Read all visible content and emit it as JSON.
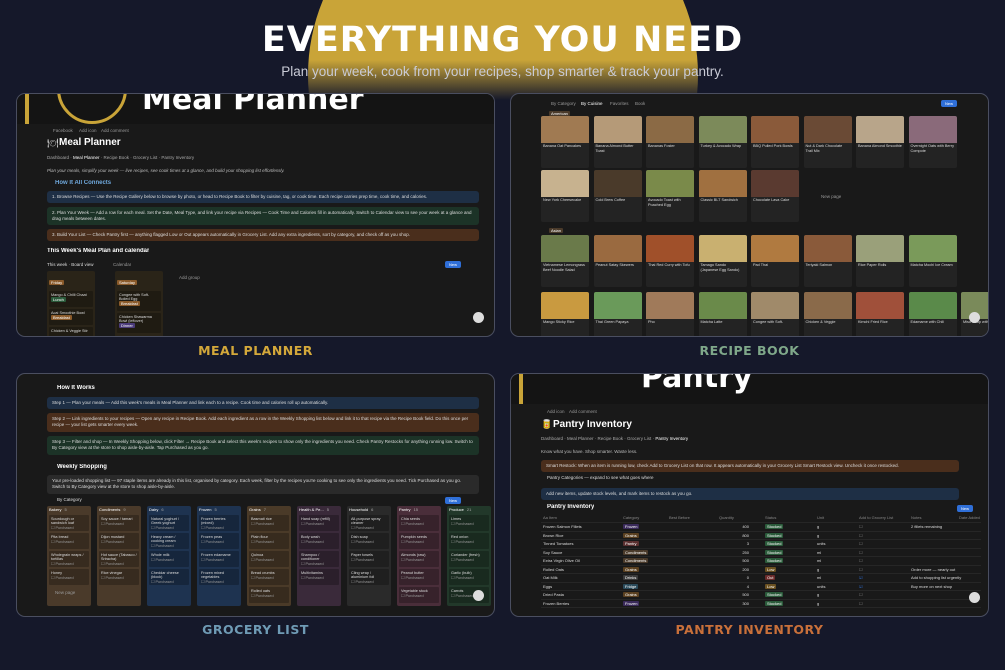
{
  "hero": {
    "title": "EVERYTHING YOU NEED",
    "subtitle": "Plan your week, cook from your recipes, shop smarter & track your pantry."
  },
  "captions": {
    "meal_planner": "MEAL PLANNER",
    "recipe_book": "RECIPE BOOK",
    "grocery_list": "GROCERY LIST",
    "pantry_inventory": "PANTRY INVENTORY"
  },
  "colors": {
    "gold": "#c9a438",
    "caption_gold": "#d4a83a",
    "caption_green": "#7fa88a",
    "caption_blue": "#6f9bb5",
    "caption_orange": "#c9703a",
    "button_blue": "#2f6fd8"
  },
  "meal_planner": {
    "cover_text": "Meal Planner",
    "cover_links": [
      "Facebook",
      "Add icon",
      "Add comment"
    ],
    "title": "Meal Planner",
    "breadcrumb": [
      "Dashboard",
      "Meal Planner",
      "Recipe Book",
      "Grocery List",
      "Pantry Inventory"
    ],
    "intro": "Plan your meals, simplify your week — live recipes, see cook times at a glance, and build your shopping list effortlessly.",
    "section_how": "How It All Connects",
    "steps": [
      "1. Browse Recipes — Use the Recipe Gallery below to browse by photo, or head to Recipe Book to filter by cuisine, tag, or cook time. Each recipe carries prep time, cook time, and calories.",
      "2. Plan Your Week — Add a row for each meal. Set the Date, Meal Type, and link your recipe via Recipes — Cook Time and Calories fill in automatically. Switch to Calendar view to see your week at a glance and drag meals between dates.",
      "3. Build Your List — Check Pantry first — anything flagged Low or Out appears automatically in Grocery List. Add any extra ingredients, sort by category, and check off as you shop."
    ],
    "section_week": "This Week's Meal Plan and calendar",
    "views": [
      "This week · Board view",
      "Calendar"
    ],
    "new_label": "New",
    "columns": [
      {
        "day": "Friday",
        "cards": [
          {
            "name": "Mango & Chilli Chaat",
            "tag": "Lunch"
          },
          {
            "name": "Acai Smoothie Bowl",
            "tag": "Breakfast"
          },
          {
            "name": "Chicken & Veggie Stir",
            "tag": ""
          }
        ]
      },
      {
        "day": "Saturday",
        "cards": [
          {
            "name": "Congee with Soft-Boiled Egg",
            "tag": "Breakfast"
          },
          {
            "name": "Chicken Shawarma Bowl (leftover)",
            "tag": "Dinner"
          }
        ]
      }
    ],
    "add_group": "Add group"
  },
  "recipe_book": {
    "tabs": [
      "By Category",
      "By Cuisine",
      "Favorites",
      "Book"
    ],
    "new_label": "New",
    "group1": "American",
    "group2": "Asian",
    "new_page": "New page",
    "row1": [
      {
        "name": "Banana Oat Pancakes",
        "color": "#a07a52"
      },
      {
        "name": "Banana Almond Butter Toast",
        "color": "#b59a78"
      },
      {
        "name": "Bananas Foster",
        "color": "#8b6a45"
      },
      {
        "name": "Turkey & Avocado Wrap",
        "color": "#7c8a5a"
      },
      {
        "name": "BBQ Pulled Pork Bowls",
        "color": "#8a5a3a"
      },
      {
        "name": "Nut & Dark Chocolate Trail Mix",
        "color": "#6a4a35"
      },
      {
        "name": "Banana Almond Smoothie",
        "color": "#b8a58a"
      },
      {
        "name": "Overnight Oats with Berry Compote",
        "color": "#8a6a7a"
      }
    ],
    "row2": [
      {
        "name": "New York Cheesecake",
        "color": "#c7b28f"
      },
      {
        "name": "Cold Brew Coffee",
        "color": "#4a3a2a"
      },
      {
        "name": "Avocado Toast with Poached Egg",
        "color": "#7a8a4a"
      },
      {
        "name": "Classic BLT Sandwich",
        "color": "#a07040"
      },
      {
        "name": "Chocolate Lava Cake",
        "color": "#5a3a30"
      }
    ],
    "row3": [
      {
        "name": "Vietnamese Lemongrass Beef Noodle Salad",
        "color": "#6a7a4a"
      },
      {
        "name": "Peanut Satay Skewers",
        "color": "#9a6a40"
      },
      {
        "name": "Thai Red Curry with Tofu",
        "color": "#a0502a"
      },
      {
        "name": "Tamago Sando (Japanese Egg Sando)",
        "color": "#c9b070"
      },
      {
        "name": "Pad Thai",
        "color": "#b07a40"
      },
      {
        "name": "Teriyaki Salmon",
        "color": "#8a5a3a"
      },
      {
        "name": "Rice Paper Rolls",
        "color": "#9aa07a"
      },
      {
        "name": "Matcha Mochi Ice Cream",
        "color": "#7a9a5a"
      }
    ],
    "row4": [
      {
        "name": "Mango Sticky Rice",
        "color": "#c99a40"
      },
      {
        "name": "Thai Green Papaya",
        "color": "#6a9a5a"
      },
      {
        "name": "Pho",
        "color": "#a07a5a"
      },
      {
        "name": "Matcha Latte",
        "color": "#6a8a4a"
      },
      {
        "name": "Congee with Soft-",
        "color": "#a08a6a"
      },
      {
        "name": "Chicken & Veggie",
        "color": "#8a6a4a"
      },
      {
        "name": "Kimchi Fried Rice",
        "color": "#a0503a"
      },
      {
        "name": "Edamame with Chili",
        "color": "#5a8a4a"
      },
      {
        "name": "Miso Soup with",
        "color": "#7a8a5a"
      }
    ]
  },
  "grocery_list": {
    "section_how": "How It Works",
    "steps": [
      "Step 1 — Plan your meals — Add this week's meals in Meal Planner and link each to a recipe. Cook time and calories roll up automatically.",
      "Step 2 — Link ingredients to your recipes — Open any recipe in Recipe Book. Add each ingredient as a row in the Weekly Shopping list below and link it to that recipe via the Recipe Book field. Do this once per recipe — your list gets smarter every week.",
      "Step 3 — Filter and shop — In Weekly Shopping below, click Filter → Recipe Book and select this week's recipes to show only the ingredients you need. Check Pantry Restocks for anything running low. Switch to By Category view at the store to shop aisle-by-aisle. Tap Purchased as you go."
    ],
    "section_weekly": "Weekly Shopping",
    "note": "Your pre-loaded shopping list — 97 staple items are already in this list, organised by category. Each week, filter by the recipes you're cooking to see only the ingredients you need. Tick Purchased as you go. Switch to By Category view at the store to shop aisle-by-aisle.",
    "view": "By Category",
    "new_label": "New",
    "purchased": "Purchased",
    "new_page": "New page",
    "columns": [
      {
        "name": "Bakery",
        "count": "5",
        "color": "#4a3a2a",
        "items": [
          "Sourdough or sandwich loaf",
          "Pita bread",
          "Wholegrain wraps / tortillas",
          "Honey"
        ]
      },
      {
        "name": "Condiments",
        "count": "9",
        "color": "#4a3a2a",
        "items": [
          "Soy sauce / tamari",
          "Dijon mustard",
          "Hot sauce (Tabasco / Sriracha)",
          "Rice vinegar"
        ]
      },
      {
        "name": "Dairy",
        "count": "6",
        "color": "#1e3350",
        "items": [
          "Natural yoghurt / Greek yoghurt",
          "Heavy cream / cooking cream",
          "Whole milk",
          "Cheddar cheese (block)"
        ]
      },
      {
        "name": "Frozen",
        "count": "5",
        "color": "#1e3350",
        "items": [
          "Frozen berries (mixed)",
          "Frozen peas",
          "Frozen edamame",
          "Frozen mixed vegetables"
        ]
      },
      {
        "name": "Grains",
        "count": "7",
        "color": "#4a3a28",
        "items": [
          "Basmati rice",
          "Plain flour",
          "Quinoa",
          "Bread crumbs",
          "Rolled oats"
        ]
      },
      {
        "name": "Health & Pe...",
        "count": "5",
        "color": "#3a2a3a",
        "items": [
          "Hand soap (refill)",
          "Body wash",
          "Shampoo / conditioner",
          "Multivitamins"
        ]
      },
      {
        "name": "Household",
        "count": "6",
        "color": "#2a2a2a",
        "items": [
          "All-purpose spray cleaner",
          "Dish soap",
          "Paper towels",
          "Cling wrap / aluminium foil"
        ]
      },
      {
        "name": "Pantry",
        "count": "15",
        "color": "#4a2e3a",
        "items": [
          "Chia seeds",
          "Pumpkin seeds",
          "Almonds (raw)",
          "Peanut butter",
          "Vegetable stock"
        ]
      },
      {
        "name": "Produce",
        "count": "21",
        "color": "#22382a",
        "items": [
          "Limes",
          "Red onion",
          "Coriander (fresh)",
          "Garlic (bulb)",
          "Carrots"
        ]
      }
    ]
  },
  "pantry": {
    "cover_text": "Pantry",
    "cover_links": [
      "Add icon",
      "Add comment"
    ],
    "title": "Pantry Inventory",
    "breadcrumb": [
      "Dashboard",
      "Meal Planner",
      "Recipe Book",
      "Grocery List",
      "Pantry Inventory"
    ],
    "intro": "Know what you have. Shop smarter. Waste less.",
    "restock_note": "Smart Restock: When an item is running low, check Add to Grocery List on that row. It appears automatically in your Grocery List Smart Restock view. Uncheck it once restocked.",
    "categories_toggle": "Pantry Categories — expand to see what goes where",
    "add_note": "Add new items, update stock levels, and mark items to restock as you go.",
    "section": "Pantry Inventory",
    "new_label": "New",
    "headers": [
      "Aa Item",
      "Category",
      "Best Before",
      "Quantity",
      "Status",
      "Unit",
      "Add to Grocery List",
      "Notes",
      "Date Added"
    ],
    "rows": [
      {
        "item": "Frozen Salmon Fillets",
        "cat": "Frozen",
        "catc": "#3a2a5a",
        "qty": "400",
        "status": "Stocked",
        "statc": "#2a5a3a",
        "unit": "g",
        "add": false,
        "note": "2 fillets remaining"
      },
      {
        "item": "Brown Rice",
        "cat": "Grains",
        "catc": "#5a4020",
        "qty": "800",
        "status": "Stocked",
        "statc": "#2a5a3a",
        "unit": "g",
        "add": false,
        "note": ""
      },
      {
        "item": "Tinned Tomatoes",
        "cat": "Pantry",
        "catc": "#5a3030",
        "qty": "3",
        "status": "Stocked",
        "statc": "#2a5a3a",
        "unit": "units",
        "add": false,
        "note": ""
      },
      {
        "item": "Soy Sauce",
        "cat": "Condiments",
        "catc": "#4a3a2a",
        "qty": "250",
        "status": "Stocked",
        "statc": "#2a5a3a",
        "unit": "ml",
        "add": false,
        "note": ""
      },
      {
        "item": "Extra Virgin Olive Oil",
        "cat": "Condiments",
        "catc": "#4a3a2a",
        "qty": "500",
        "status": "Stocked",
        "statc": "#2a5a3a",
        "unit": "ml",
        "add": false,
        "note": ""
      },
      {
        "item": "Rolled Oats",
        "cat": "Grains",
        "catc": "#5a4020",
        "qty": "200",
        "status": "Low",
        "statc": "#6a5020",
        "unit": "g",
        "add": false,
        "note": "Order more — nearly out"
      },
      {
        "item": "Oat Milk",
        "cat": "Drinks",
        "catc": "#3a3a3a",
        "qty": "0",
        "status": "Out",
        "statc": "#6a2a2a",
        "unit": "ml",
        "add": true,
        "note": "Add to shopping list urgently"
      },
      {
        "item": "Eggs",
        "cat": "Fridge",
        "catc": "#2a4a5a",
        "qty": "4",
        "status": "Low",
        "statc": "#6a5020",
        "unit": "units",
        "add": true,
        "note": "Buy more on next shop"
      },
      {
        "item": "Dried Pasta",
        "cat": "Grains",
        "catc": "#5a4020",
        "qty": "500",
        "status": "Stocked",
        "statc": "#2a5a3a",
        "unit": "g",
        "add": false,
        "note": ""
      },
      {
        "item": "Frozen Berries",
        "cat": "Frozen",
        "catc": "#3a2a5a",
        "qty": "300",
        "status": "Stocked",
        "statc": "#2a5a3a",
        "unit": "g",
        "add": false,
        "note": ""
      }
    ]
  }
}
